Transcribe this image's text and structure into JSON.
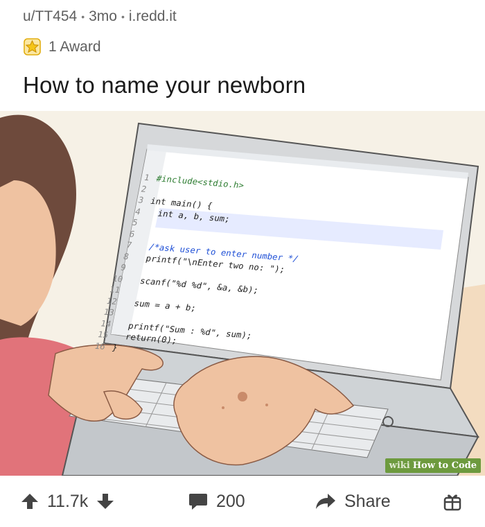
{
  "post": {
    "author": "u/TT454",
    "age": "3mo",
    "domain": "i.redd.it",
    "awards": "1 Award",
    "title": "How to name your newborn"
  },
  "image": {
    "code_lines": [
      {
        "num": "1",
        "text": "#include<stdio.h>"
      },
      {
        "num": "2",
        "text": ""
      },
      {
        "num": "3",
        "text": "int main() {"
      },
      {
        "num": "4",
        "text": "  int a, b, sum;"
      },
      {
        "num": "5",
        "text": ""
      },
      {
        "num": "6",
        "text": ""
      },
      {
        "num": "7",
        "text": "  /*ask user to enter number */"
      },
      {
        "num": "8",
        "text": "  printf(\"\\nEnter two no: \");"
      },
      {
        "num": "9",
        "text": ""
      },
      {
        "num": "10",
        "text": "  scanf(\"%d %d\", &a, &b);"
      },
      {
        "num": "11",
        "text": ""
      },
      {
        "num": "12",
        "text": "  sum = a + b;"
      },
      {
        "num": "13",
        "text": ""
      },
      {
        "num": "14",
        "text": "  printf(\"Sum : %d\", sum);"
      },
      {
        "num": "15",
        "text": "  return(0);"
      },
      {
        "num": "16",
        "text": "}"
      }
    ],
    "watermark_wiki": "wiki",
    "watermark_text": "How to Code"
  },
  "actions": {
    "votes": "11.7k",
    "comments": "200",
    "share": "Share"
  },
  "colors": {
    "meta_text": "#5f5f5f",
    "award_gold": "#f5c518",
    "action_icon": "#444444",
    "watermark_green": "#6d9a3e"
  }
}
